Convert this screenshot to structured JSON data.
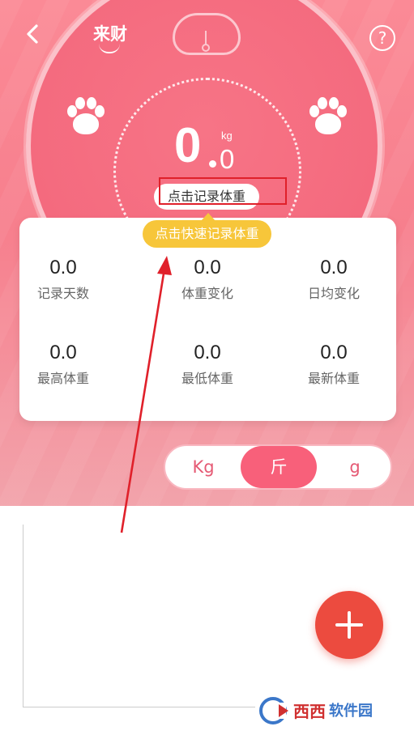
{
  "header": {
    "title": "来财",
    "back_icon": "back-arrow-icon",
    "help_label": "?"
  },
  "weight": {
    "integer": "0",
    "decimal": "0",
    "unit": "kg"
  },
  "record_button": "点击记录体重",
  "tip": "点击快速记录体重",
  "stats": [
    {
      "value": "0.0",
      "label": "记录天数"
    },
    {
      "value": "0.0",
      "label": "体重变化"
    },
    {
      "value": "0.0",
      "label": "日均变化"
    },
    {
      "value": "0.0",
      "label": "最高体重"
    },
    {
      "value": "0.0",
      "label": "最低体重"
    },
    {
      "value": "0.0",
      "label": "最新体重"
    }
  ],
  "units": {
    "options": [
      "Kg",
      "斤",
      "g"
    ],
    "selected": "斤"
  },
  "fab_icon": "plus-icon",
  "watermark": {
    "text1": "西西",
    "text2": "软件园"
  },
  "colors": {
    "hero": "#f77f8d",
    "accent": "#f8607a",
    "tip": "#f7c63a",
    "fab": "#ec4b3f",
    "annotation": "#e0202a"
  }
}
